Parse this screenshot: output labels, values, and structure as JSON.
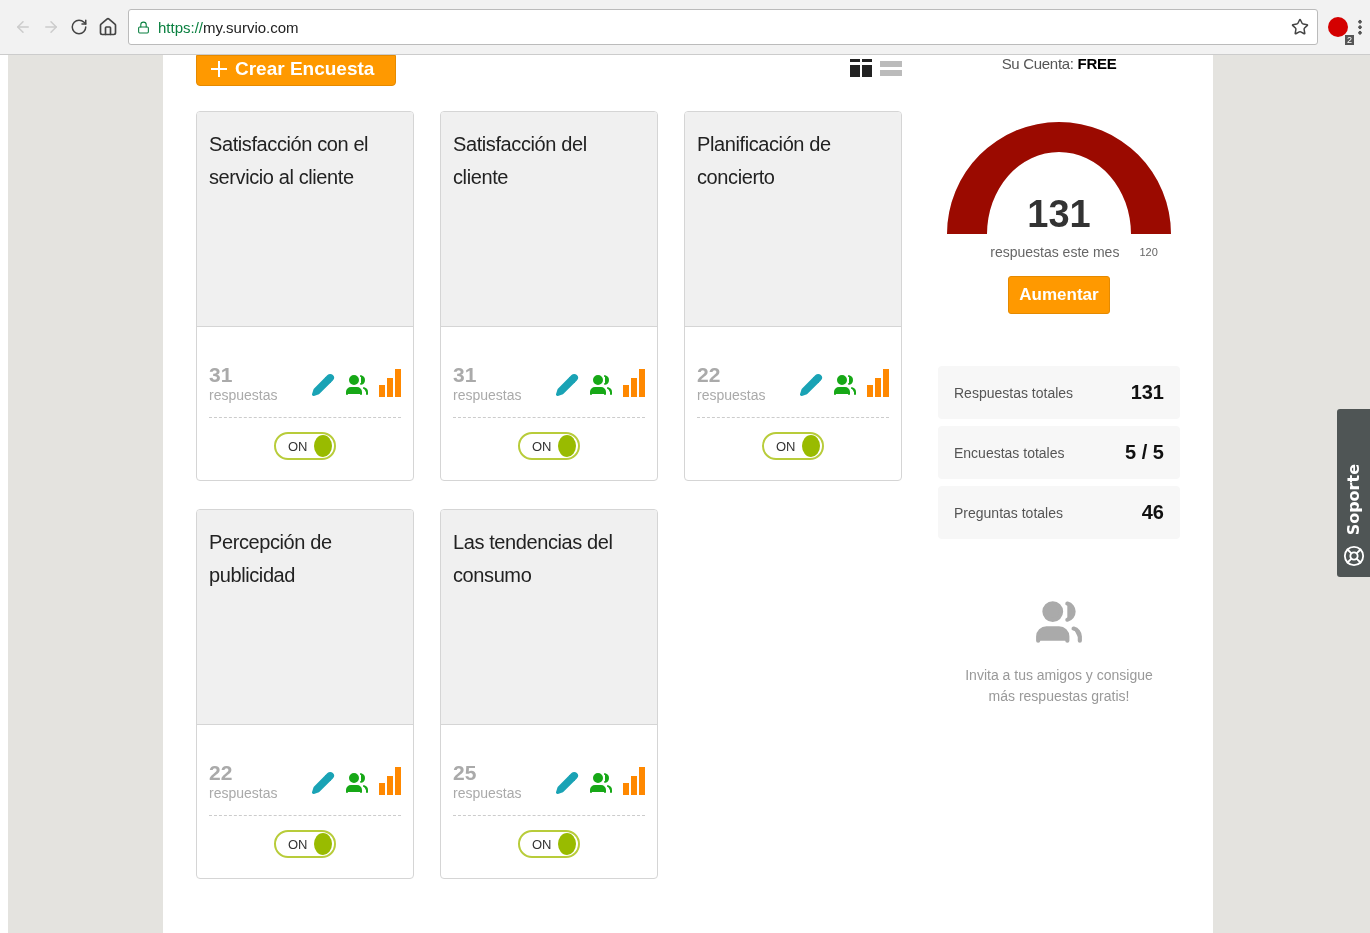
{
  "browser": {
    "url_scheme": "https://",
    "url_host": "my.survio.com",
    "extension_badge": "2"
  },
  "create_button": {
    "label": "Crear Encuesta"
  },
  "view": [
    {
      "kind": "grid",
      "selected": true
    },
    {
      "kind": "list",
      "selected": false
    }
  ],
  "surveys": [
    {
      "title": "Satisfacción con el servicio al cliente",
      "count": "31",
      "count_label": "respuestas",
      "toggle_label": "ON",
      "on": true
    },
    {
      "title": "Satisfacción del cliente",
      "count": "31",
      "count_label": "respuestas",
      "toggle_label": "ON",
      "on": true
    },
    {
      "title": "Planificación de concierto",
      "count": "22",
      "count_label": "respuestas",
      "toggle_label": "ON",
      "on": true
    },
    {
      "title": "Percepción de publicidad",
      "count": "22",
      "count_label": "respuestas",
      "toggle_label": "ON",
      "on": true
    },
    {
      "title": "Las tendencias del consumo",
      "count": "25",
      "count_label": "respuestas",
      "toggle_label": "ON",
      "on": true
    }
  ],
  "account": {
    "label": "Su Cuenta:",
    "plan": "FREE",
    "gauge_value": "131",
    "gauge_caption": "respuestas este mes",
    "gauge_max": "120",
    "level": 1,
    "upgrade_button": "Aumentar"
  },
  "stats": [
    {
      "label": "Respuestas totales",
      "value": "131"
    },
    {
      "label": "Encuestas totales",
      "value": "5 / 5"
    },
    {
      "label": "Preguntas totales",
      "value": "46"
    }
  ],
  "invite": {
    "text": "Invita a tus amigos y consigue más respuestas gratis!"
  },
  "support_tab": {
    "label": "Soporte"
  }
}
